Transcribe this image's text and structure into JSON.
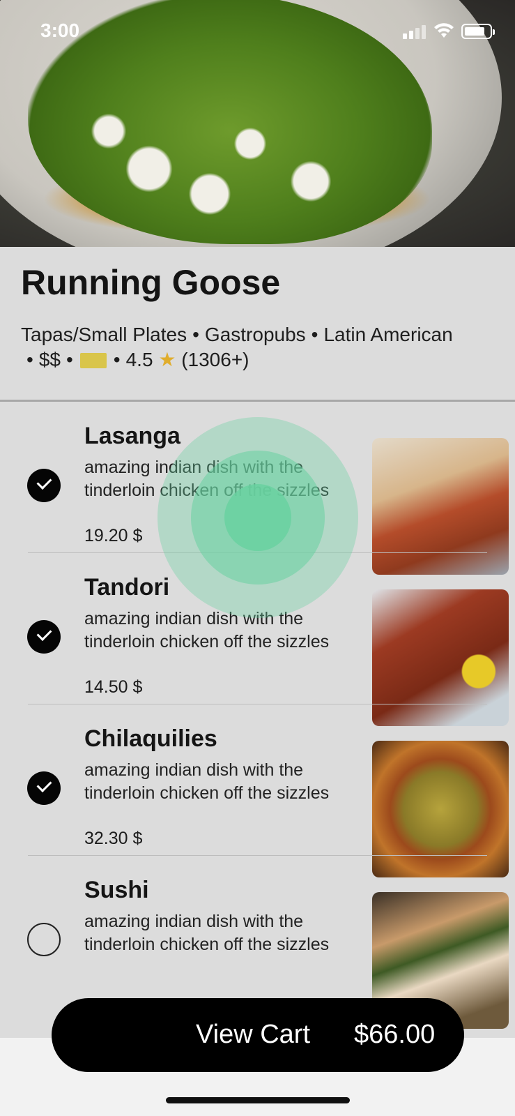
{
  "status_bar": {
    "time": "3:00"
  },
  "restaurant": {
    "name": "Running Goose",
    "categories": [
      "Tapas/Small Plates",
      "Gastropubs",
      "Latin American"
    ],
    "price_level": "$$",
    "rating": "4.5",
    "review_count": "(1306+)"
  },
  "menu": {
    "items": [
      {
        "name": "Lasanga",
        "description": "amazing indian dish with the tinderloin chicken off the sizzles",
        "price": "19.20 $",
        "selected": true,
        "image": "lasagna"
      },
      {
        "name": "Tandori",
        "description": "amazing indian dish with the tinderloin chicken off the sizzles",
        "price": "14.50 $",
        "selected": true,
        "image": "tandoori-chicken"
      },
      {
        "name": "Chilaquilies",
        "description": "amazing indian dish with the tinderloin chicken off the sizzles",
        "price": "32.30 $",
        "selected": true,
        "image": "chilaquiles"
      },
      {
        "name": "Sushi",
        "description": "amazing indian dish with the tinderloin chicken off the sizzles",
        "price": "",
        "selected": false,
        "image": "sushi"
      }
    ]
  },
  "cart": {
    "label": "View Cart",
    "total": "$66.00"
  },
  "colors": {
    "cart_button": "#000000",
    "tap_indicator": "#68d1a0",
    "page_background": "#dcdcdc"
  }
}
